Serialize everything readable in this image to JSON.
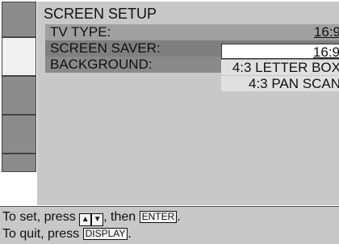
{
  "menu": {
    "title": "SCREEN SETUP",
    "rows": [
      {
        "label": "TV TYPE:",
        "value": "16:9"
      },
      {
        "label": "SCREEN SAVER:"
      },
      {
        "label": "BACKGROUND:"
      }
    ],
    "dropdown_options": [
      "16:9",
      "4:3 LETTER BOX",
      "4:3 PAN SCAN"
    ],
    "selected_option": "16:9"
  },
  "help": {
    "line1_prefix": "To set, press",
    "up_arrow": "▲",
    "down_arrow": "▼",
    "line1_mid": ", then",
    "enter_key": "ENTER",
    "line1_suffix": ".",
    "line2_prefix": "To quit, press",
    "display_key": "DISPLAY",
    "line2_suffix": "."
  },
  "colors": {
    "panel": "#c8c8c8",
    "row_highlight": "#7f7f7f",
    "tab_dark": "#8c8c8c",
    "tab_active": "#f0f0f0"
  }
}
